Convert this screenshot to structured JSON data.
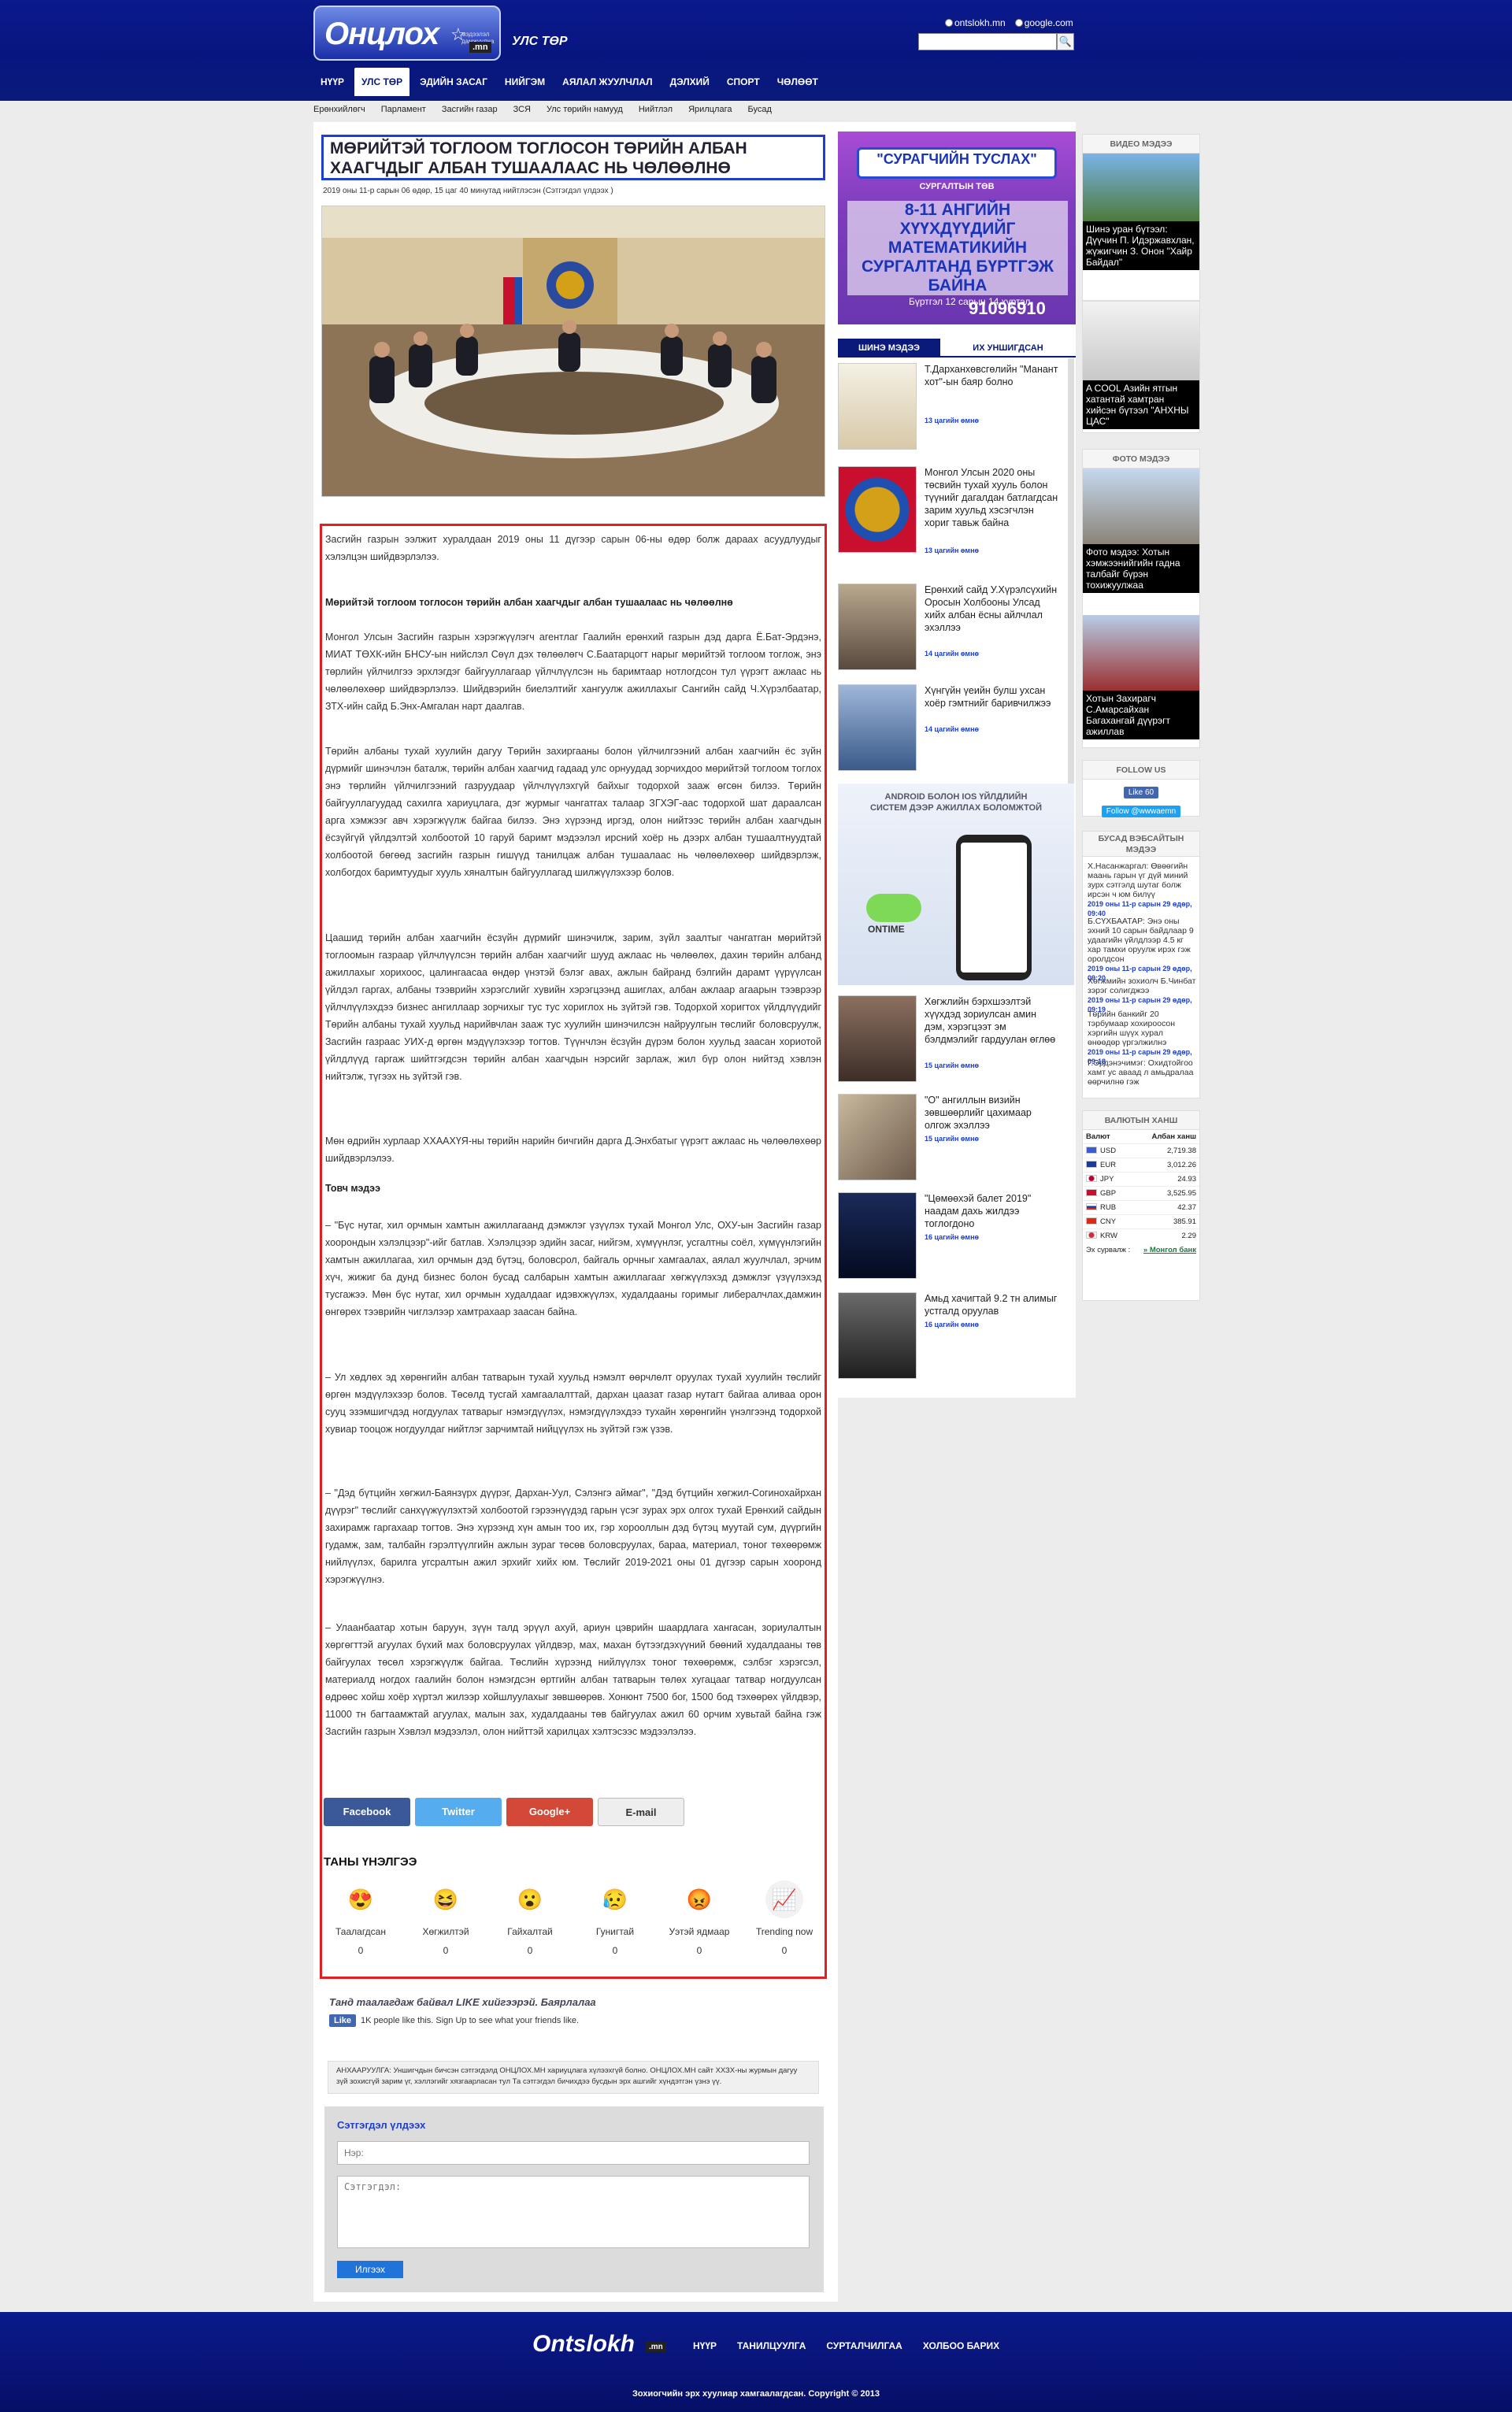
{
  "header": {
    "logo_text": "Онцлох",
    "logo_tagline": "мэдээлэл дамжуулна",
    "logo_domain": ".mn",
    "section_title": "УЛС ТӨР",
    "search_options": [
      "ontslokh.mn",
      "google.com"
    ],
    "search_value": "",
    "search_button": "🔍"
  },
  "nav": {
    "items": [
      "НҮҮР",
      "УЛС ТӨР",
      "ЭДИЙН ЗАСАГ",
      "НИЙГЭМ",
      "АЯЛАЛ ЖУУЛЧЛАЛ",
      "ДЭЛХИЙ",
      "СПОРТ",
      "ЧӨЛӨӨТ"
    ],
    "active": "УЛС ТӨР"
  },
  "subnav": {
    "items": [
      "Ерөнхийлөгч",
      "Парламент",
      "Засгийн газар",
      "ЗСЯ",
      "Улс төрийн намууд",
      "Нийтлэл",
      "Ярилцлага",
      "Бусад"
    ]
  },
  "article": {
    "title": "МӨРИЙТЭЙ ТОГЛООМ ТОГЛОСОН ТӨРИЙН АЛБАН ХААГЧДЫГ АЛБАН ТУШААЛААС НЬ ЧӨЛӨӨЛНӨ",
    "meta": "2019 оны 11-р сарын 06 өдөр, 15 цаг 40 минутад нийтлэсэн (Сэтгэгдэл үлдээх )",
    "paragraphs": [
      "Засгийн газрын ээлжит хуралдаан 2019 оны 11 дүгээр сарын 06-ны өдөр болж дараах асуудлуудыг хэлэлцэн шийдвэрлэлээ.",
      "Мөрийтэй тоглоом тоглосон төрийн албан хаагчдыг албан тушаалаас нь чөлөөлнө",
      "Монгол Улсын Засгийн газрын хэрэгжүүлэгч агентлаг Гаалийн ерөнхий газрын дэд дарга Ё.Бат-Эрдэнэ, МИАТ ТӨХК-ийн БНСУ-ын нийслэл Сөүл дэх төлөөлөгч С.Баатарцогт нарыг мөрийтэй тоглоом тоглож, энэ төрлийн үйлчилгээ эрхлэгдэг байгууллагаар үйлчлүүлсэн нь баримтаар нотлогдсон тул үүрэгт ажлаас нь чөлөөлөхөөр шийдвэрлэлээ. Шийдвэрийн биелэлтийг хангуулж ажиллахыг Сангийн сайд Ч.Хүрэлбаатар, ЗТХ-ийн сайд Б.Энх-Амгалан нарт даалгав.",
      "Төрийн албаны тухай хуулийн дагуу Төрийн захиргааны болон үйлчилгээний албан хаагчийн ёс зүйн дүрмийг шинэчлэн баталж, төрийн албан хаагчид гадаад улс орнуудад зорчихдоо мөрийтэй тоглоом тоглох энэ төрлийн үйлчилгээний газруудаар үйлчлүүлэхгүй байхыг тодорхой зааж өгсөн билээ. Төрийн байгууллагуудад сахилга хариуцлага, дэг журмыг чангатгах талаар ЗГХЭГ-аас тодорхой шат дараалсан арга хэмжээг авч хэрэгжүүлж байгаа билээ. Энэ хүрээнд иргэд, олон нийтээс төрийн албан хаагчдын ёсзүйгүй үйлдэлтэй холбоотой 10 гаруй баримт мэдээлэл ирсний хоёр нь дээрх албан тушаалтнуудтай холбоотой бөгөөд засгийн газрын гишүүд танилцаж албан тушаалаас нь чөлөөлөхөөр шийдвэрлэж, холбогдох баримтуудыг хууль хяналтын байгууллагад шилжүүлэхээр болов.",
      "Цаашид төрийн албан хаагчийн ёсзүйн дүрмийг шинэчилж, зарим, зүйл заалтыг чангатган мөрийтэй тоглоомын газраар үйлчлүүлсэн төрийн албан хаагчийг шууд ажлаас нь чөлөөлөх, дахин төрийн албанд ажиллахыг хорихоос, цалингаасаа өндөр үнэтэй бэлэг авах, ажлын байранд бэлгийн дарамт үүрүүлсан үйлдэл гаргах, албаны тээврийн хэрэгслийг хувийн хэрэгцээнд ашиглах, албан ажлаар агаарын тээврээр үйлчлүүлэхдээ бизнес ангиллаар зорчихыг тус тус хориглох нь зүйтэй гэв. Тодорхой хоригтох үйлдлүүдийг Төрийн албаны тухай хуульд нарийвчлан зааж тус хуулийн шинэчилсэн найруулгын төслийг боловсруулж, Засгийн газраас УИХ-д өргөн мэдүүлэхээр тогтов. Түүнчлэн ёсзүйн дүрэм болон хуульд заасан хориотой үйлдлүүд гаргаж шийтгэгдсэн төрийн албан хаагчдын нэрсийг зарлаж, жил бүр олон нийтэд хэвлэн нийтэлж, түгээх нь зүйтэй гэв.",
      "Мөн өдрийн хурлаар ХХААХҮЯ-ны төрийн нарийн бичгийн дарга Д.Энхбатыг үүрэгт ажлаас нь чөлөөлөхөөр шийдвэрлэлээ.",
      "Товч мэдээ",
      "– \"Бүс нутаг, хил орчмын хамтын ажиллагаанд дэмжлэг үзүүлэх тухай Монгол Улс, ОХУ-ын Засгийн газар хоорондын хэлэлцээр\"-ийг батлав. Хэлэлцээр эдийн засаг, нийгэм, хүмүүнлэг, усгалтны соёл, хүмүүнлэгийн хамтын ажиллагаа, хил орчмын дэд бүтэц, боловсрол, байгаль орчныг хамгаалах, аялал жуулчлал, эрчим хүч, жижиг ба дунд бизнес болон бусад салбарын хамтын ажиллагааг хөгжүүлэхэд дэмжлэг үзүүлэхэд тусгажээ. Мөн бүс нутаг, хил орчмын худалдааг идэвхжүүлэх, худалдааны горимыг либералчлах,дамжин өнгөрөх тээврийн чиглэлээр хамтрахаар заасан байна.",
      "– Ул хөдлөх эд хөрөнгийн албан татварын тухай хуульд нэмэлт өөрчлөлт оруулах тухай хуулийн төслийг өргөн мэдүүлэхээр болов. Төсөлд тусгай хамгаалалттай, дархан цаазат газар нутагт байгаа аливаа орон сууц эзэмшигчдэд ногдуулах татварыг нэмэгдүүлэх, нэмэгдүүлэхдээ тухайн хөрөнгийн үнэлгээнд тодорхой хувиар тооцож ногдуулдаг нийтлэг зарчимтай нийцүүлэх нь зүйтэй гэж үзэв.",
      "– \"Дэд бүтцийн хөгжил-Баянзүрх дүүрэг, Дархан-Уул, Сэлэнгэ аймаг\", \"Дэд бүтцийн хөгжил-Согинохайрхан дүүрэг\" төслийг санхүүжүүлэхтэй холбоотой гэрээнүүдэд гарын үсэг зурах эрх олгох тухай Ерөнхий сайдын захирамж гаргахаар тогтов. Энэ хүрээнд хүн амын тоо их, гэр хорооллын дэд бүтэц муутай сум, дүүргийн гудамж, зам, талбайн гэрэлтүүлгийн ажлын зураг төсөв боловсруулах, бараа, материал, тоног төхөөрөмж нийлүүлэх, барилга угсралтын ажил эрхийг хийх юм. Төслийг 2019-2021 оны 01 дүгээр сарын хооронд хэрэгжүүлнэ.",
      "– Улаанбаатар хотын баруун, зүүн талд эрүүл ахуй, ариун цэврийн шаардлага хангасан, зориулалтын хөргөгттэй агуулах бүхий мах боловсруулах үйлдвэр, мах, махан бүтээгдэхүүний бөөний худалдааны төв байгуулах төсөл хэрэгжүүлж байгаа. Төслийн хүрээнд нийлүүлэх тоног төхөөрөмж, сэлбэг хэрэгсэл, материалд ногдох гаалийн болон нэмэгдсэн өртгийн албан татварын төлөх хугацааг татвар ногдуулсан өдрөөс хойш хоёр хүртэл жилээр хойшлуулахыг зөвшөөрөв. Хонюнт 7500 бог, 1500 бод тэхөөрөх үйлдвэр, 11000 тн багтаамжтай агуулах, малын зах, худалдааны төв байгуулах ажил 60 орчим хувьтай байна гэж Засгийн газрын Хэвлэл мэдээлэл, олон нийттэй харилцах хэлтэсээс мэдээлэлээ."
    ],
    "share": [
      "Facebook",
      "Twitter",
      "Google+",
      "E-mail"
    ],
    "reactions_title": "ТАНЫ ҮНЭЛГЭЭ",
    "reactions": [
      {
        "label": "Таалагдсан",
        "count": "0",
        "icon": "😍"
      },
      {
        "label": "Хөгжилтэй",
        "count": "0",
        "icon": "😆"
      },
      {
        "label": "Гайхалтай",
        "count": "0",
        "icon": "😮"
      },
      {
        "label": "Гунигтай",
        "count": "0",
        "icon": "😥"
      },
      {
        "label": "Уэтэй ядмаар",
        "count": "0",
        "icon": "😡"
      },
      {
        "label": "Trending now",
        "count": "0",
        "icon": "📈"
      }
    ]
  },
  "like_box": {
    "title": "Танд таалагдаж байвал LIKE хийгээрэй. Баярлалаа",
    "button": "Like",
    "text": "1K people like this. Sign Up to see what your friends like."
  },
  "notice": "АНХААРУУЛГА: Уншигчдын бичсэн сэтгэгдэлд ОНЦЛОХ.МН хариуцлага хүлээхгүй болно. ОНЦЛОХ.МН сайт ХХЗХ-ны журмын дагуу зүй зохисгүй зарим үг, хэллэгийг хязгаарласан тул Та сэтгэгдэл бичихдээ бусдын эрх ашгийг хүндэтгэн үзнэ үү.",
  "comments": {
    "title": "Сэтгэгдэл үлдээх",
    "name_placeholder": "Нэр:",
    "comment_placeholder": "Сэтгэгдэл:",
    "submit": "Илгээх"
  },
  "banner": {
    "title": "\"СУРАГЧИЙН ТУСЛАХ\"",
    "subtitle": "СУРГАЛТЫН ТӨВ",
    "headline": "8-11 АНГИЙН ХҮҮХДҮҮДИЙГ МАТЕМАТИКИЙН СУРГАЛТАНД БҮРТГЭЖ БАЙНА",
    "date": "Бүртгэл 12 сарын 14 хүртэл",
    "phone": "91096910"
  },
  "tabs": [
    "ШИНЭ МЭДЭЭ",
    "ИХ УНШИГДСАН"
  ],
  "news": [
    {
      "title": "Т.Дарханхөвсгөлийн \"Манант хот\"-ын баяр болно",
      "time": "13 цагийн өмнө"
    },
    {
      "title": "Монгол Улсын 2020 оны төсвийн тухай хууль болон түүнийг дагалдан батлагдсан зарим хуульд хэсэгчлэн хориг тавьж байна",
      "time": "13 цагийн өмнө"
    },
    {
      "title": "Ерөнхий сайд У.Хүрэлсүхийн Оросын Холбооны Улсад хийх албан ёсны айлчлал эхэллээ",
      "time": "14 цагийн өмнө"
    },
    {
      "title": "Хүнгүйн үеийн булш ухсан хоёр гэмтнийг баривчилжээ",
      "time": "14 цагийн өмнө"
    },
    {
      "title": "Хөгжлийн бэрхшээлтэй хүүхдэд зориулсан амин дэм, хэрэгцээт эм бэлдмэлийг гардуулан өглөө",
      "time": "15 цагийн өмнө"
    },
    {
      "title": "\"О\" ангиллын визийн зөвшөөрлийг цахимаар олгож эхэллээ",
      "time": "15 цагийн өмнө"
    },
    {
      "title": "\"Цөмөөхэй балет 2019\" наадам дахь жилдээ тоглогдоно",
      "time": "16 цагийн өмнө"
    },
    {
      "title": "Амьд хачигтай 9.2 тн алимыг устгалд оруулав",
      "time": "16 цагийн өмнө"
    }
  ],
  "app_ad": {
    "title": "ANDROID БОЛОН IOS ҮЙЛДЛИЙН СИСТЕМ ДЭЭР АЖИЛЛАХ БОЛОМЖТОЙ",
    "brand": "ONTIME"
  },
  "side": {
    "video_title": "ВИДЕО МЭДЭЭ",
    "videos": [
      "Шинэ уран бүтээл: Дүүчин П. Идэржавхлан, жүжигчин З. Онон \"Хайр Байдал\"",
      "A COOL Азийн ятгын хатантай хамтран хийсэн бүтээл \"АНХНЫ ЦАС\""
    ],
    "photo_title": "ФОТО МЭДЭЭ",
    "photos": [
      "Фото мэдээ: Хотын хэмжээнийгийн гадна талбайг бүрэн тохижуулжаа",
      "Хотын Захирагч С.Амарсайхан Багахангай дүүрэгт ажиллав"
    ],
    "follow_title": "FOLLOW US",
    "fb_like": "Like 60",
    "tw_follow": "Follow @wwwaemn",
    "other_title": "БУСАД ВЭБСАЙТЫН МЭДЭЭ",
    "others": [
      {
        "title": "Х.Насанжаргал: Өвөөгийн маань гарын үг дүй миний зурх сэтгэлд шутаг болж ирсэн ч юм билүү",
        "time": "2019 оны 11-р сарын 29 өдөр, 09:40"
      },
      {
        "title": "Б.СҮХБААТАР: Энэ оны эхний 10 сарын байдлаар 9 удаагийн үйлдлээр 4.5 кг хар тамхи оруулж ирэх гэж оролдсон",
        "time": "2019 оны 11-р сарын 29 өдөр, 09:20"
      },
      {
        "title": "Хөгжмийн зохиолч Б.Чинбат зэрэг солигджээ",
        "time": "2019 оны 11-р сарын 29 өдөр, 09:19"
      },
      {
        "title": "Төрийн банкийг 20 тэрбумаар хохироосон хэргийн шүүх хурал өнөөдөр үргэлжилнэ",
        "time": "2019 оны 11-р сарын 29 өдөр, 09:18"
      },
      {
        "title": "Г.Эрдэнэчимэг: Охидтойгоо хамт ус аваад л амьдралаа өөрчилнө гэж",
        "time": ""
      }
    ],
    "rates_title": "ВАЛЮТЫН ХАНШ",
    "rates_headers": [
      "Валют",
      "Албан ханш"
    ],
    "rates": [
      {
        "code": "USD",
        "rate": "2,719.38",
        "color": "#3b5bd6"
      },
      {
        "code": "EUR",
        "rate": "3,012.26",
        "color": "#1b3a9e"
      },
      {
        "code": "JPY",
        "rate": "24.93",
        "color": "#ffffff"
      },
      {
        "code": "GBP",
        "rate": "3,525.95",
        "color": "#c8102e"
      },
      {
        "code": "RUB",
        "rate": "42.37",
        "color": "#d52b1e"
      },
      {
        "code": "CNY",
        "rate": "385.91",
        "color": "#de2910"
      },
      {
        "code": "KRW",
        "rate": "2.29",
        "color": "#f4f4f4"
      }
    ],
    "rates_source_label": "Эх сурвалж :",
    "rates_source": "» Монгол банк"
  },
  "footer": {
    "logo": "Ontslokh",
    "domain": ".mn",
    "nav": [
      "НҮҮР",
      "ТАНИЛЦУУЛГА",
      "СУРТАЛЧИЛГАА",
      "ХОЛБОО БАРИХ"
    ],
    "copyright": "Зохиогчийн эрх хуулиар хамгаалагдсан. Copyright © 2013"
  }
}
